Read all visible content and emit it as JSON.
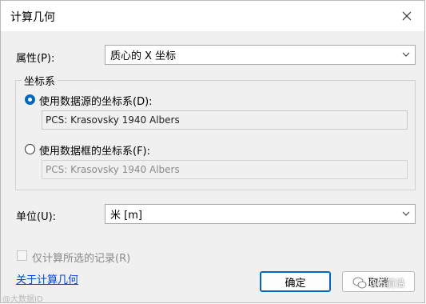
{
  "window": {
    "title": "计算几何"
  },
  "property": {
    "label": "属性(P):",
    "value": "质心的 X 坐标"
  },
  "coordinate_system": {
    "group_label": "坐标系",
    "source_option": {
      "label": "使用数据源的坐标系(D):",
      "selected": true,
      "value": "PCS: Krasovsky 1940 Albers"
    },
    "frame_option": {
      "label": "使用数据框的坐标系(F):",
      "selected": false,
      "value": "PCS: Krasovsky 1940 Albers"
    }
  },
  "unit": {
    "label": "单位(U):",
    "value": "米 [m]"
  },
  "selected_only": {
    "label": "仅计算所选的记录(R)",
    "checked": false
  },
  "about_link": "关于计算几何",
  "buttons": {
    "ok": "确定",
    "cancel": "取消"
  },
  "watermarks": {
    "left": "@大数据ID",
    "right": "GIS前沿"
  }
}
